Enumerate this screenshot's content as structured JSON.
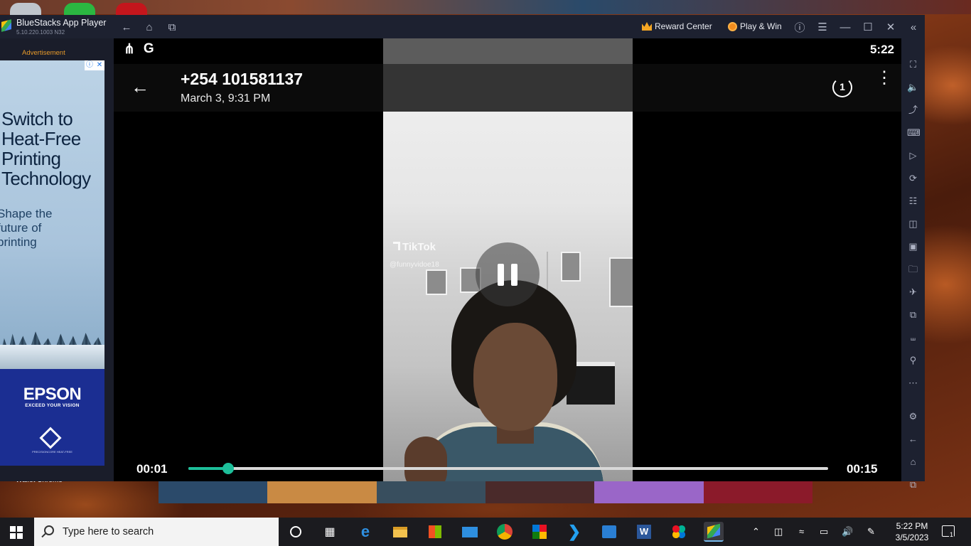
{
  "window": {
    "app_name": "BlueStacks App Player",
    "version": "5.10.220.1003 N32",
    "reward_center": "Reward Center",
    "play_win": "Play & Win"
  },
  "ad": {
    "label": "Advertisement",
    "headline": "Switch to\nHeat-Free\nPrinting\nTechnology",
    "subhead": "Shape the\nfuture of\nprinting",
    "brand": "EPSON",
    "tagline": "EXCEED YOUR VISION",
    "badge": "PRECISIONCORE HEAT-FREE"
  },
  "phone": {
    "status_time": "5:22",
    "header": {
      "contact": "+254 101581137",
      "date": "March 3, 9:31 PM",
      "timer_label": "1"
    },
    "video": {
      "watermark": "TikTok",
      "username": "@funnyvidoe18"
    },
    "player": {
      "current_time": "00:01",
      "total_time": "00:15",
      "progress_fraction": 0.062,
      "accent_color": "#1dbf9a"
    }
  },
  "taskbar": {
    "search_placeholder": "Type here to search",
    "time": "5:22 PM",
    "date": "3/5/2023",
    "notification_count": "1"
  },
  "desktop": {
    "partial_labels": "Wallet   Chrome"
  }
}
